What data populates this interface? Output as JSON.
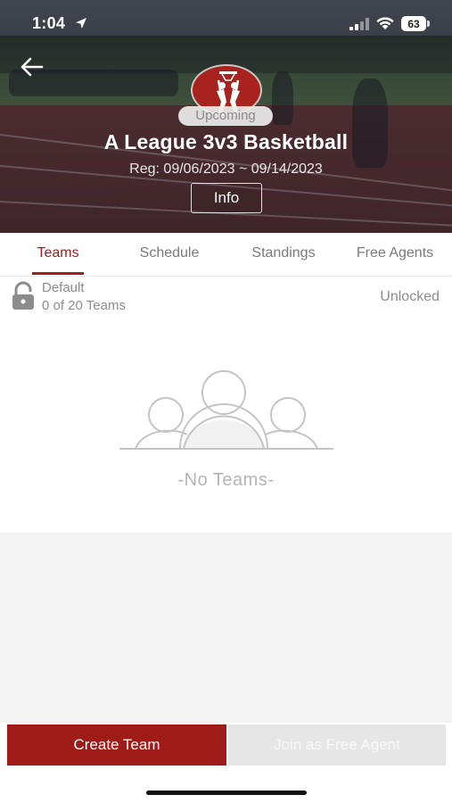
{
  "status_bar": {
    "time": "1:04",
    "battery": "63",
    "icons": [
      "location-arrow-icon",
      "cellular-signal-icon",
      "wifi-icon",
      "battery-icon"
    ]
  },
  "header": {
    "back_icon": "arrow-left-icon",
    "logo_icon": "basketball-league-logo",
    "badge": "Upcoming",
    "title": "A League 3v3 Basketball",
    "registration": "Reg: 09/06/2023 ~ 09/14/2023",
    "info_label": "Info"
  },
  "tabs": [
    {
      "label": "Teams",
      "active": true
    },
    {
      "label": "Schedule",
      "active": false
    },
    {
      "label": "Standings",
      "active": false
    },
    {
      "label": "Free Agents",
      "active": false
    }
  ],
  "division": {
    "icon": "lock-icon",
    "name": "Default",
    "count": "0 of 20 Teams",
    "status": "Unlocked"
  },
  "empty_state": {
    "icon": "people-group-icon",
    "text": "-No Teams-"
  },
  "actions": {
    "create_label": "Create Team",
    "join_label": "Join as Free Agent"
  },
  "colors": {
    "accent": "#a51e1b",
    "button_primary": "#9e1b17",
    "button_disabled": "#e6e6e6",
    "muted_text": "#8c8c8c",
    "empty_text": "#b4b4b4",
    "background_gray": "#f3f3f3"
  }
}
